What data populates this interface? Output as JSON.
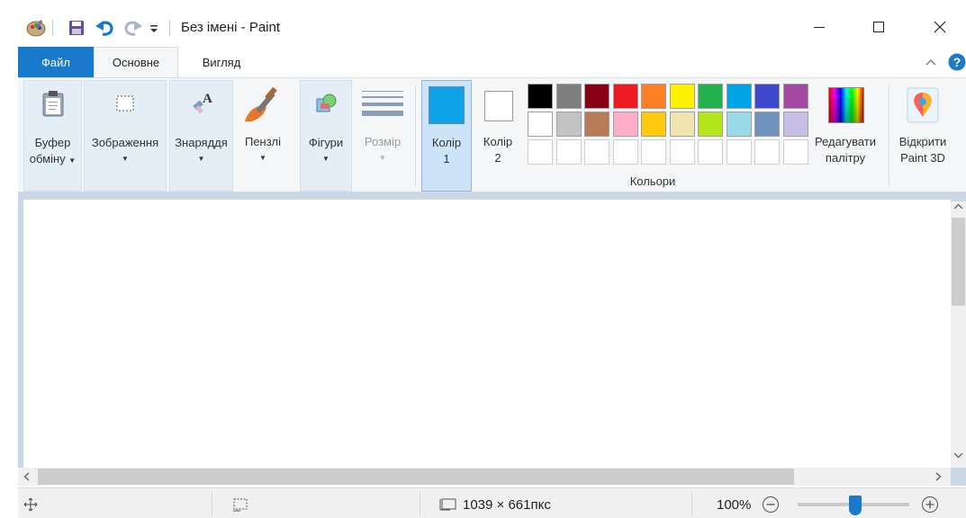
{
  "window": {
    "title": "Без імені - Paint",
    "minimize_icon": "minimize-icon",
    "maximize_icon": "maximize-icon",
    "close_icon": "close-icon"
  },
  "quick_access": {
    "icons": [
      "paint-app-icon",
      "save-icon",
      "undo-icon",
      "redo-icon",
      "customize-dropdown-icon"
    ]
  },
  "tabs": {
    "file": "Файл",
    "home": "Основне",
    "view": "Вигляд"
  },
  "ribbon": {
    "clipboard": {
      "line1": "Буфер",
      "line2": "обміну"
    },
    "image": {
      "label": "Зображення"
    },
    "tools": {
      "label": "Знаряддя"
    },
    "brushes": {
      "label": "Пензлі"
    },
    "shapes": {
      "label": "Фігури"
    },
    "size": {
      "label": "Розмір"
    },
    "color1": {
      "line1": "Колір",
      "line2": "1",
      "color": "#0ea2e8"
    },
    "color2": {
      "line1": "Колір",
      "line2": "2",
      "color": "#ffffff"
    },
    "colors_group_label": "Кольори",
    "edit_colors": {
      "line1": "Редагувати",
      "line2": "палітру"
    },
    "paint3d": {
      "line1": "Відкрити",
      "line2": "Paint 3D"
    },
    "palette_row1": [
      "#000000",
      "#7f7f7f",
      "#880015",
      "#ed1c24",
      "#ff7f27",
      "#fff200",
      "#22b14c",
      "#00a2e8",
      "#3f48cc",
      "#a349a4"
    ],
    "palette_row2": [
      "#ffffff",
      "#c3c3c3",
      "#b97a57",
      "#ffaec9",
      "#ffc90e",
      "#efe4b0",
      "#b5e61d",
      "#99d9ea",
      "#7092be",
      "#c8bfe7"
    ]
  },
  "status": {
    "canvas_size": "1039 × 661пкс",
    "zoom": "100%",
    "zoom_level": 0.5
  }
}
